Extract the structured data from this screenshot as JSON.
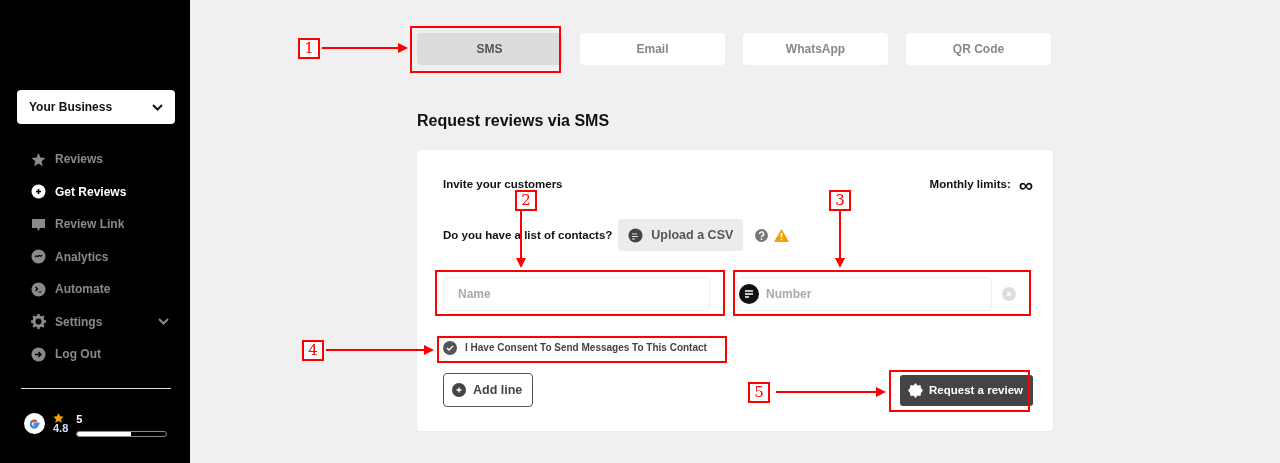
{
  "sidebar": {
    "business": {
      "label": "Your Business"
    },
    "items": [
      {
        "label": "Reviews",
        "selected": false
      },
      {
        "label": "Get Reviews",
        "selected": true
      },
      {
        "label": "Review Link",
        "selected": false
      },
      {
        "label": "Analytics",
        "selected": false
      },
      {
        "label": "Automate",
        "selected": false
      },
      {
        "label": "Settings",
        "selected": false,
        "expandable": true
      },
      {
        "label": "Log Out",
        "selected": false
      }
    ],
    "rating": {
      "score": "4.8",
      "count": "5",
      "level": 0.6
    }
  },
  "tabs": [
    {
      "label": "SMS",
      "selected": true
    },
    {
      "label": "Email",
      "selected": false
    },
    {
      "label": "WhatsApp",
      "selected": false
    },
    {
      "label": "QR Code",
      "selected": false
    }
  ],
  "heading": "Request reviews via SMS",
  "form": {
    "title": "Invite your customers",
    "limits_label": "Monthly limits:",
    "limits_value": "∞",
    "contacts_question": "Do you have a list of contacts?",
    "upload_button": "Upload a CSV",
    "name_field": {
      "placeholder": "Name"
    },
    "number_field": {
      "placeholder": "Number"
    },
    "consent": {
      "label": "I Have Consent To Send Messages To This Contact",
      "checked": true
    },
    "add_button": "Add line",
    "submit_button": "Request a review"
  },
  "annotations": [
    {
      "label": "1"
    },
    {
      "label": "2"
    },
    {
      "label": "3"
    },
    {
      "label": "4"
    },
    {
      "label": "5"
    }
  ]
}
